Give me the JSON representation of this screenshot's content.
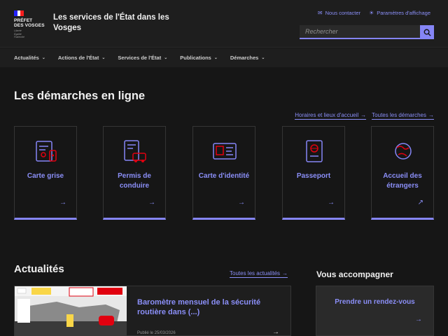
{
  "header": {
    "logo_lines": [
      "PRÉFET",
      "DES VOSGES"
    ],
    "motto": [
      "Liberté",
      "Égalité",
      "Fraternité"
    ],
    "site_title": "Les services de l'État dans les Vosges",
    "contact_label": "Nous contacter",
    "display_label": "Paramètres d'affichage",
    "search_placeholder": "Rechercher",
    "accent": "#8585f6"
  },
  "nav": {
    "items": [
      "Actualités",
      "Actions de l'État",
      "Services de l'État",
      "Publications",
      "Démarches"
    ]
  },
  "demarches": {
    "title": "Les démarches en ligne",
    "links": [
      "Horaires et lieux d'accueil",
      "Toutes les démarches"
    ],
    "cards": [
      {
        "label": "Carte grise",
        "icon": "car-registration-icon",
        "arrow": "→"
      },
      {
        "label": "Permis de conduire",
        "icon": "driving-licence-icon",
        "arrow": "→"
      },
      {
        "label": "Carte d'identité",
        "icon": "identity-card-icon",
        "arrow": "→"
      },
      {
        "label": "Passeport",
        "icon": "passport-icon",
        "arrow": "→"
      },
      {
        "label": "Accueil des étrangers",
        "icon": "globe-icon",
        "arrow": "↗"
      }
    ]
  },
  "actualites": {
    "title": "Actualités",
    "all_link": "Toutes les actualités",
    "news": [
      {
        "title": "Baromètre mensuel de la sécurité routière dans (...)",
        "date": "Publié le 25/03/2026"
      }
    ]
  },
  "accompagner": {
    "title": "Vous accompagner",
    "card_label": "Prendre un rendez-vous"
  }
}
